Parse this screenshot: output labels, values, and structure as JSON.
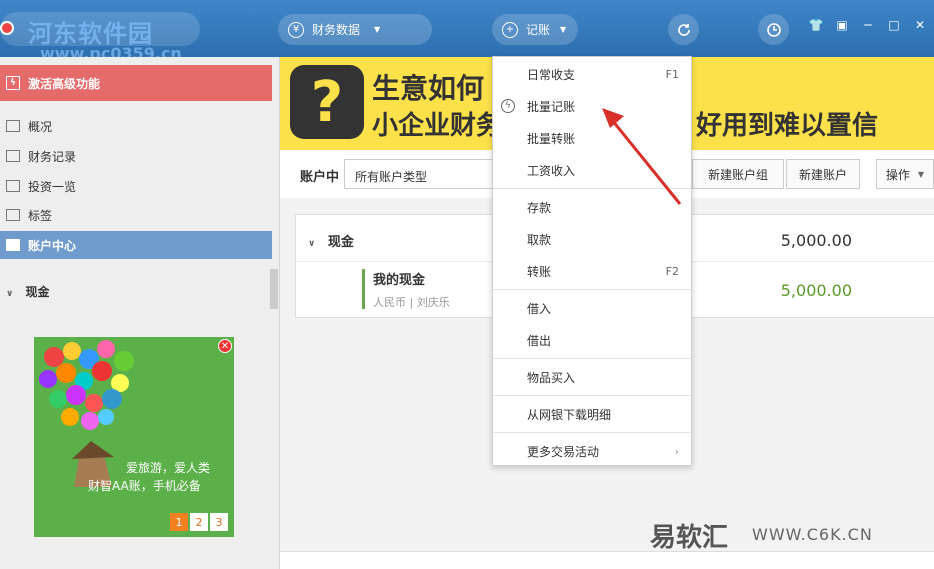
{
  "topbar": {
    "watermark": "河东软件园",
    "watermark_url": "www.pc0359.cn",
    "finance_label": "财务数据",
    "record_label": "记账"
  },
  "sidebar": {
    "activate_label": "激活高级功能",
    "items": [
      {
        "label": "概况"
      },
      {
        "label": "财务记录"
      },
      {
        "label": "投资一览"
      },
      {
        "label": "标签"
      },
      {
        "label": "账户中心"
      }
    ],
    "section": "现金",
    "ad": {
      "line1": "爱旅游，爱人类",
      "line2": "财智AA账，手机必备",
      "pages": [
        "1",
        "2",
        "3"
      ]
    }
  },
  "banner": {
    "line1": "生意如何",
    "line2": "小企业财务",
    "line3": "好用到难以置信"
  },
  "account_bar": {
    "label": "账户中",
    "select_value": "所有账户类型",
    "new_group": "新建账户组",
    "new_account": "新建账户",
    "ops": "操作"
  },
  "card": {
    "group": "现金",
    "group_total": "5,000.00",
    "account_name": "我的现金",
    "account_sub": "人民币 | 刘庆乐",
    "account_total": "5,000.00"
  },
  "menu": {
    "items": [
      {
        "label": "日常收支",
        "key": "F1"
      },
      {
        "label": "批量记账",
        "key": ""
      },
      {
        "label": "批量转账",
        "key": ""
      },
      {
        "label": "工资收入",
        "key": ""
      },
      {
        "label": "存款",
        "key": ""
      },
      {
        "label": "取款",
        "key": ""
      },
      {
        "label": "转账",
        "key": "F2"
      },
      {
        "label": "借入",
        "key": ""
      },
      {
        "label": "借出",
        "key": ""
      },
      {
        "label": "物品买入",
        "key": ""
      },
      {
        "label": "从网银下载明细",
        "key": ""
      },
      {
        "label": "更多交易活动",
        "key": ""
      }
    ]
  },
  "footer_watermark": {
    "brand": "易软汇",
    "url": "WWW.C6K.CN"
  },
  "colors": {
    "topbar": "#2c6fb0",
    "activate": "#e56b6b",
    "active_nav": "#6f9ccc",
    "banner": "#fde14a",
    "positive": "#5a9a2a",
    "arrow": "#d9302a"
  }
}
